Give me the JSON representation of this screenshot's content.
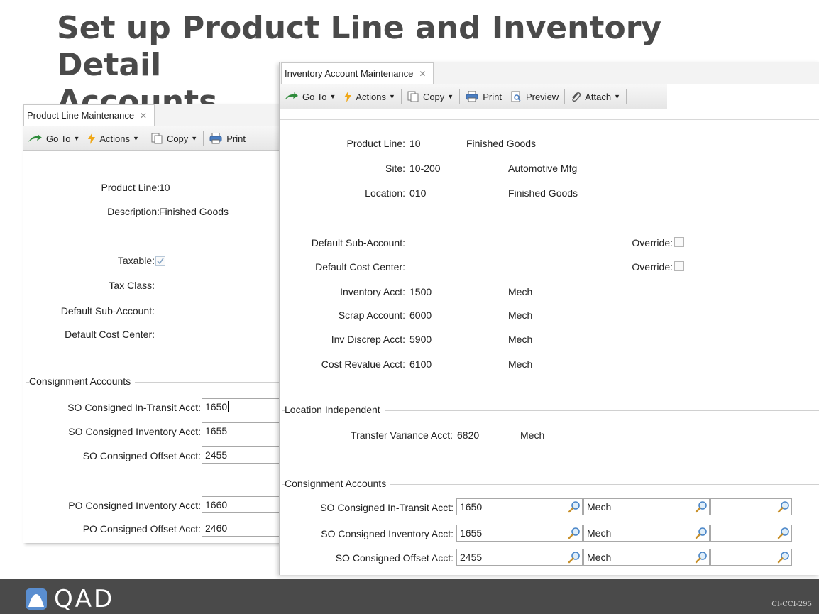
{
  "slide": {
    "title_line1": "Set up Product Line and Inventory Detail",
    "title_line2": "Accounts"
  },
  "plm": {
    "tab_label": "Product Line Maintenance",
    "tab_close": "✕",
    "toolbar": {
      "goto": "Go To",
      "actions": "Actions",
      "copy": "Copy",
      "print": "Print"
    },
    "fields": {
      "product_line_label": "Product Line:",
      "product_line_value": "10",
      "description_label": "Description:",
      "description_value": "Finished Goods",
      "taxable_label": "Taxable:",
      "taxable_checked": true,
      "tax_class_label": "Tax Class:",
      "default_sub_account_label": "Default Sub-Account:",
      "default_cost_center_label": "Default Cost Center:"
    },
    "consignment": {
      "group_label": "Consignment Accounts",
      "so_in_transit_label": "SO Consigned In-Transit Acct:",
      "so_in_transit_value": "1650",
      "so_inventory_label": "SO Consigned Inventory Acct:",
      "so_inventory_value": "1655",
      "so_offset_label": "SO Consigned Offset Acct:",
      "so_offset_value": "2455",
      "po_inventory_label": "PO Consigned Inventory Acct:",
      "po_inventory_value": "1660",
      "po_offset_label": "PO Consigned Offset Acct:",
      "po_offset_value": "2460"
    }
  },
  "iam": {
    "tab_label": "Inventory Account Maintenance",
    "tab_close": "✕",
    "toolbar": {
      "goto": "Go To",
      "actions": "Actions",
      "copy": "Copy",
      "print": "Print",
      "preview": "Preview",
      "attach": "Attach"
    },
    "header": {
      "product_line_label": "Product Line:",
      "product_line_value": "10",
      "product_line_desc": "Finished Goods",
      "site_label": "Site:",
      "site_value": "10-200",
      "site_desc": "Automotive Mfg",
      "location_label": "Location:",
      "location_value": "010",
      "location_desc": "Finished Goods"
    },
    "accounts": {
      "default_sub_account_label": "Default Sub-Account:",
      "default_cost_center_label": "Default Cost Center:",
      "override_label": "Override:",
      "inventory_label": "Inventory Acct:",
      "inventory_value": "1500",
      "inventory_desc": "Mech",
      "scrap_label": "Scrap Account:",
      "scrap_value": "6000",
      "scrap_desc": "Mech",
      "inv_discrep_label": "Inv Discrep Acct:",
      "inv_discrep_value": "5900",
      "inv_discrep_desc": "Mech",
      "cost_revalue_label": "Cost Revalue Acct:",
      "cost_revalue_value": "6100",
      "cost_revalue_desc": "Mech"
    },
    "location_independent": {
      "group_label": "Location Independent",
      "transfer_variance_label": "Transfer Variance Acct:",
      "transfer_variance_value": "6820",
      "transfer_variance_desc": "Mech"
    },
    "consignment": {
      "group_label": "Consignment Accounts",
      "rows": [
        {
          "label": "SO Consigned In-Transit Acct:",
          "account": "1650",
          "sub": "Mech",
          "cc": ""
        },
        {
          "label": "SO Consigned Inventory Acct:",
          "account": "1655",
          "sub": "Mech",
          "cc": ""
        },
        {
          "label": "SO Consigned Offset Acct:",
          "account": "2455",
          "sub": "Mech",
          "cc": ""
        }
      ]
    }
  },
  "footer": {
    "brand": "QAD",
    "code": "CI-CCI-295"
  }
}
